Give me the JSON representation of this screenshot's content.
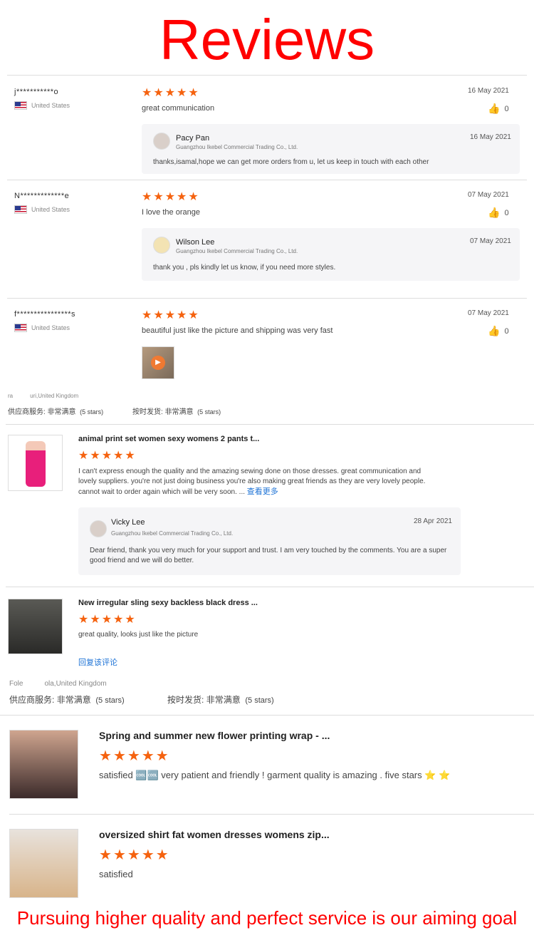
{
  "page": {
    "title": "Reviews",
    "footer": "Pursuing higher quality and perfect service is our aiming goal"
  },
  "star_char": "★",
  "colors": {
    "star": "#f5620f",
    "title": "#ff0000",
    "link": "#1e73d6"
  },
  "reviews": [
    {
      "user": "j***********o",
      "country": "United States",
      "rating": 5,
      "text": "great communication",
      "date": "16 May 2021",
      "likes": "0",
      "reply": {
        "name": "Pacy Pan",
        "company": "Guangzhou Ikebel Commercial Trading Co., Ltd.",
        "date": "16 May 2021",
        "text": "thanks,isamal,hope we can get more orders from u, let us keep in touch with each other"
      }
    },
    {
      "user": "N*************e",
      "country": "United States",
      "rating": 5,
      "text": "I love the orange",
      "date": "07 May 2021",
      "likes": "0",
      "reply": {
        "name": "Wilson Lee",
        "company": "Guangzhou Ikebel Commercial Trading Co., Ltd.",
        "date": "07 May 2021",
        "text": "thank you , pls kindly let us know, if you need more styles."
      }
    },
    {
      "user": "f****************s",
      "country": "United States",
      "rating": 5,
      "text": "beautiful just like the picture and shipping was very fast",
      "date": "07 May 2021",
      "likes": "0"
    }
  ],
  "supplier_rating_1": {
    "location": "ra　　　uri,United Kingdom",
    "service_label": "供应商服务:",
    "service_value": "非常满意",
    "service_stars": "(5 stars)",
    "ship_label": "按时发货:",
    "ship_value": "非常满意",
    "ship_stars": "(5 stars)"
  },
  "product_reviews": [
    {
      "title": "animal print set women sexy womens 2 pants t...",
      "rating": 5,
      "text": "I can't express enough the quality and the amazing sewing done on those dresses. great communication and lovely suppliers. you're not just doing business you're also making great friends as they are very lovely people. cannot wait to order again which will be very soon. ...",
      "more": "查看更多",
      "reply": {
        "name": "Vicky Lee",
        "company": "Guangzhou Ikebel Commercial Trading Co., Ltd.",
        "date": "28 Apr 2021",
        "text": "Dear friend, thank you very much for your support and trust. I am very touched by the comments. You are a super good friend and we will do better."
      }
    },
    {
      "title": "New irregular sling sexy backless black dress ...",
      "rating": 5,
      "text": "great quality, looks just like the picture",
      "link": "回复该评论"
    }
  ],
  "supplier_rating_2": {
    "location": "Fole　　　ola,United Kingdom",
    "service_label": "供应商服务:",
    "service_value": "非常满意",
    "service_stars": "(5 stars)",
    "ship_label": "按时发货:",
    "ship_value": "非常满意",
    "ship_stars": "(5 stars)"
  },
  "big_reviews": [
    {
      "title": "Spring and summer new flower printing wrap - ...",
      "rating": 5,
      "text": "satisfied 🆒🆒 very patient and friendly ! garment quality is amazing . five stars ⭐ ⭐"
    },
    {
      "title": "oversized shirt fat women dresses womens zip...",
      "rating": 5,
      "text": "satisfied"
    }
  ]
}
